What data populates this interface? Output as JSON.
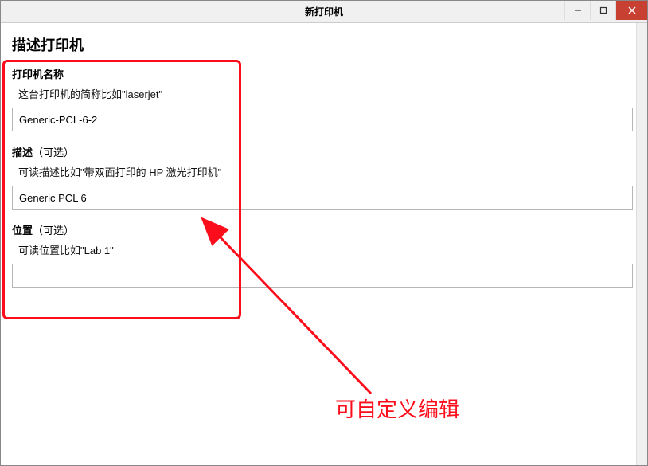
{
  "window": {
    "title": "新打印机",
    "minimize": "—",
    "maximize": "☐",
    "close": "✕"
  },
  "heading": "描述打印机",
  "fields": {
    "name": {
      "label_bold": "打印机名称",
      "label_optional": "",
      "hint": "这台打印机的简称比如\"laserjet\"",
      "value": "Generic-PCL-6-2"
    },
    "description": {
      "label_bold": "描述",
      "label_optional": "（可选）",
      "hint": "可读描述比如\"带双面打印的 HP 激光打印机\"",
      "value": "Generic PCL 6"
    },
    "location": {
      "label_bold": "位置",
      "label_optional": "（可选）",
      "hint": "可读位置比如\"Lab 1\"",
      "value": ""
    }
  },
  "annotation": {
    "text": "可自定义编辑"
  },
  "colors": {
    "highlight": "#fc0d1b",
    "close_btn": "#c84031"
  }
}
